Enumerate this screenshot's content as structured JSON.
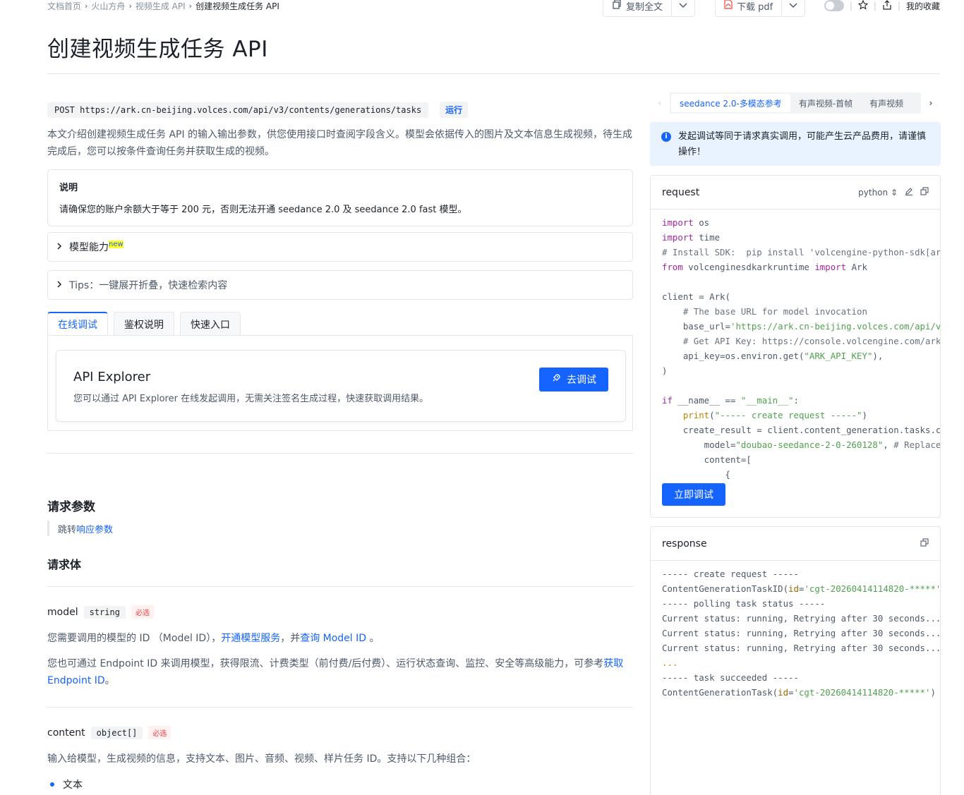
{
  "breadcrumb": [
    "文档首页",
    "火山方舟",
    "视频生成 API",
    "创建视频生成任务 API"
  ],
  "topbar": {
    "copy_label": "复制全文",
    "pdf_label": "下载 pdf",
    "favorites_label": "我的收藏"
  },
  "page_title": "创建视频生成任务 API",
  "endpoint": {
    "method_url": "POST https://ark.cn-beijing.volces.com/api/v3/contents/generations/tasks",
    "run_label": "运行"
  },
  "intro": "本文介绍创建视频生成任务 API 的输入输出参数，供您使用接口时查阅字段含义。模型会依据传入的图片及文本信息生成视频，待生成完成后，您可以按条件查询任务并获取生成的视频。",
  "note": {
    "title": "说明",
    "body": "请确保您的账户余额大于等于 200 元，否则无法开通 seedance 2.0 及 seedance 2.0 fast 模型。"
  },
  "collapses": [
    {
      "label": "模型能力",
      "tag": "new"
    },
    {
      "label": "Tips：一键展开折叠，快速检索内容",
      "tag": ""
    }
  ],
  "tabs": [
    "在线调试",
    "鉴权说明",
    "快速入口"
  ],
  "explorer": {
    "title": "API Explorer",
    "desc": "您可以通过 API Explorer 在线发起调用，无需关注签名生成过程，快速获取调用结果。",
    "button": "去调试"
  },
  "request_params": {
    "heading": "请求参数",
    "jump_prefix": "跳转 ",
    "jump_link": "响应参数",
    "body_heading": "请求体"
  },
  "params": [
    {
      "name": "model",
      "type": "string",
      "required": "必选",
      "p1_a": "您需要调用的模型的 ID （Model ID），",
      "p1_link1": "开通模型服务",
      "p1_b": "，并",
      "p1_link2": "查询 Model ID",
      "p1_c": " 。",
      "p2_a": "您也可通过 Endpoint ID 来调用模型，获得限流、计费类型（前付费/后付费）、运行状态查询、监控、安全等高级能力，可参考",
      "p2_link": "获取 Endpoint ID",
      "p2_b": "。"
    },
    {
      "name": "content",
      "type": "object[]",
      "required": "必选",
      "p1": "输入给模型，生成视频的信息，支持文本、图片、音频、视频、样片任务 ID。支持以下几种组合："
    }
  ],
  "bullets": [
    "文本"
  ],
  "right_tabs": [
    "seedance 2.0-多模态参考",
    "有声视频-首帧",
    "有声视频"
  ],
  "alert": "发起调试等同于请求真实调用，可能产生云产品费用，请谨慎操作！",
  "request_panel": {
    "title": "request",
    "language": "python",
    "run_button": "立即调试"
  },
  "response_panel": {
    "title": "response"
  },
  "colors": {
    "accent": "#1664ff",
    "border": "#e5e6eb",
    "alert_bg": "#e8f3ff"
  }
}
